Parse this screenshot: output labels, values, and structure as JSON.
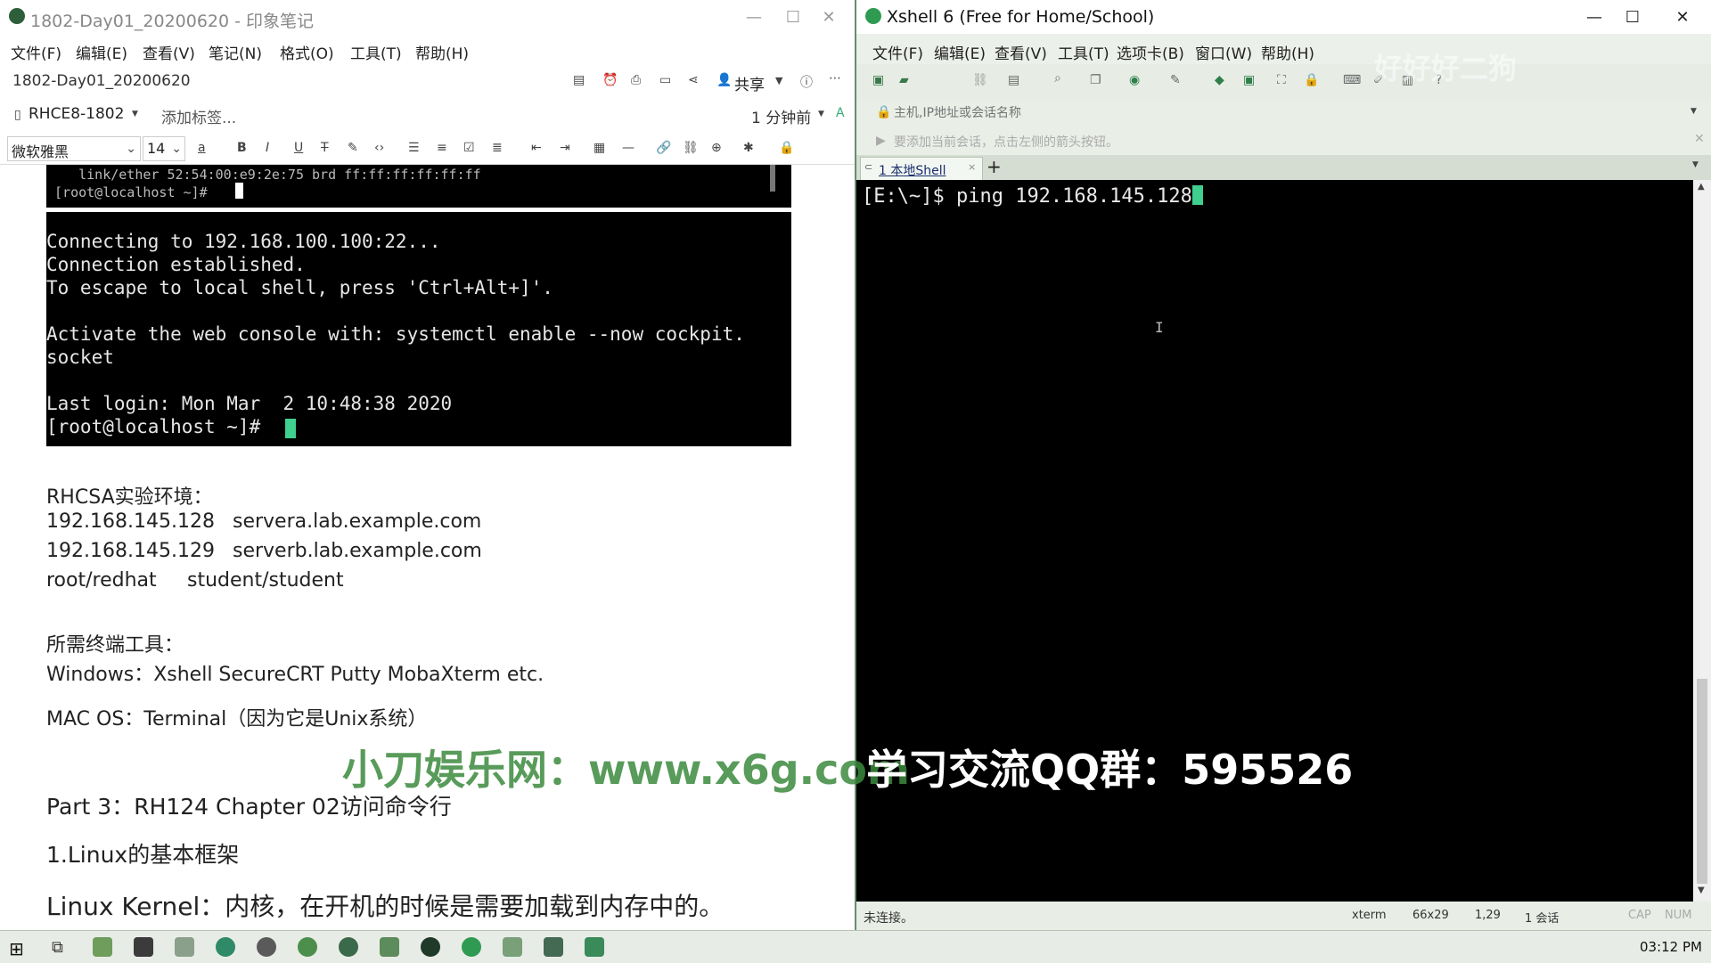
{
  "evernote": {
    "title": "1802-Day01_20200620 - 印象笔记",
    "menu": [
      "文件(F)",
      "编辑(E)",
      "查看(V)",
      "笔记(N)",
      "格式(O)",
      "工具(T)",
      "帮助(H)"
    ],
    "note_title": "1802-Day01_20200620",
    "share_label": "共享",
    "notebook": "RHCE8-1802",
    "add_tag": "添加标签...",
    "modified": "1 分钟前",
    "font_name": "微软雅黑",
    "font_size": "14",
    "terminal_top": {
      "line1": "    link/ether 52:54:00:e9:2e:75 brd ff:ff:ff:ff:ff:ff",
      "line2": " [root@localhost ~]# "
    },
    "terminal_main": [
      "Connecting to 192.168.100.100:22...",
      "Connection established.",
      "To escape to local shell, press 'Ctrl+Alt+]'.",
      "",
      "Activate the web console with: systemctl enable --now cockpit.",
      "socket",
      "",
      "Last login: Mon Mar  2 10:48:38 2020",
      "[root@localhost ~]# "
    ],
    "body": {
      "env_heading": "RHCSA实验环境：",
      "env_line1_ip": "192.168.145.128",
      "env_line1_host": "servera.lab.example.com",
      "env_line2_ip": "192.168.145.129",
      "env_line2_host": "serverb.lab.example.com",
      "creds_a": "root/redhat",
      "creds_b": "student/student",
      "tools_heading": "所需终端工具：",
      "tools_windows": "Windows：Xshell SecureCRT Putty MobaXterm etc.",
      "tools_mac": "MAC OS：Terminal（因为它是Unix系统）",
      "part3": "Part 3：RH124 Chapter 02访问命令行",
      "section1": "1.Linux的基本框架",
      "kernel": "Linux Kernel：内核，在开机的时候是需要加载到内存中的。"
    }
  },
  "xshell": {
    "title": "Xshell 6 (Free for Home/School)",
    "menu": [
      "文件(F)",
      "编辑(E)",
      "查看(V)",
      "工具(T)",
      "选项卡(B)",
      "窗口(W)",
      "帮助(H)"
    ],
    "address_placeholder": "主机,IP地址或会话名称",
    "hint": "要添加当前会话，点击左侧的箭头按钮。",
    "tab_label": "1 本地Shell",
    "add_tab": "+",
    "prompt": "[E:\\~]$ ",
    "command": "ping 192.168.145.128",
    "status": {
      "state": "未连接。",
      "term": "xterm",
      "size": "66x29",
      "cursor": "1,29",
      "sessions": "1 会话",
      "cap": "CAP",
      "num": "NUM"
    }
  },
  "watermarks": {
    "site": "小刀娱乐网：www.x6g.com",
    "qq": "学习交流QQ群：595526",
    "top_right": "好好好二狗"
  },
  "taskbar": {
    "time": "03:12 PM"
  },
  "colors": {
    "watermark_green": "#3c8a3e",
    "terminal_bg": "#000000",
    "cursor_green": "#3fcf8e",
    "taskbar_bg": "#e8ece6"
  }
}
